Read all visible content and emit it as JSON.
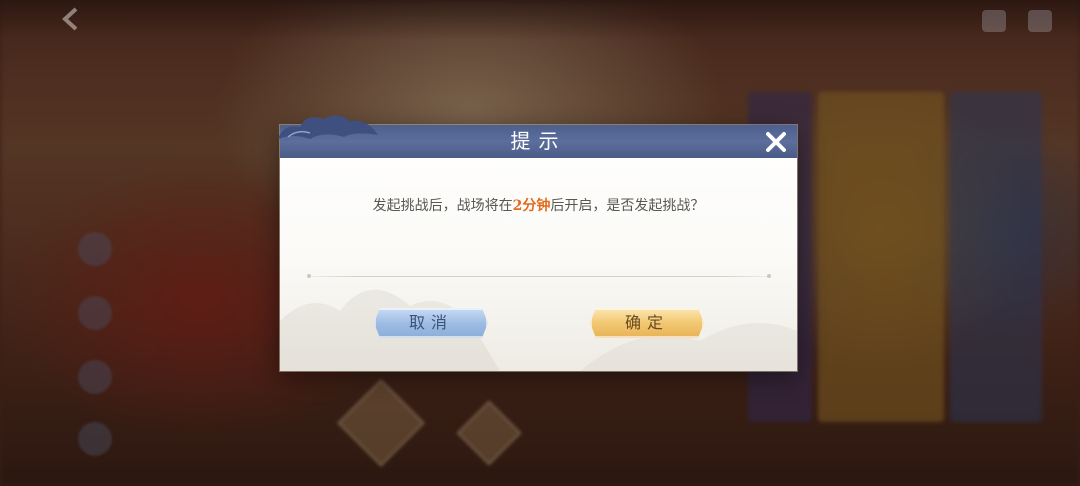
{
  "top_bar": {
    "back_icon": "back-arrow-icon",
    "title": "",
    "right_icons": [
      "chat-icon",
      "mail-icon"
    ]
  },
  "dialog": {
    "title": "提示",
    "close_icon": "close-icon",
    "message_part1": "发起挑战后，战场将在",
    "message_highlight": "2分钟",
    "message_part2": "后开启，是否发起挑战？",
    "highlight_color": "#e26a1c",
    "cancel_label": "取消",
    "confirm_label": "确定"
  },
  "colors": {
    "header": "#4d5f8e",
    "cancel_button": "#9fbde3",
    "confirm_button": "#f2c872"
  }
}
